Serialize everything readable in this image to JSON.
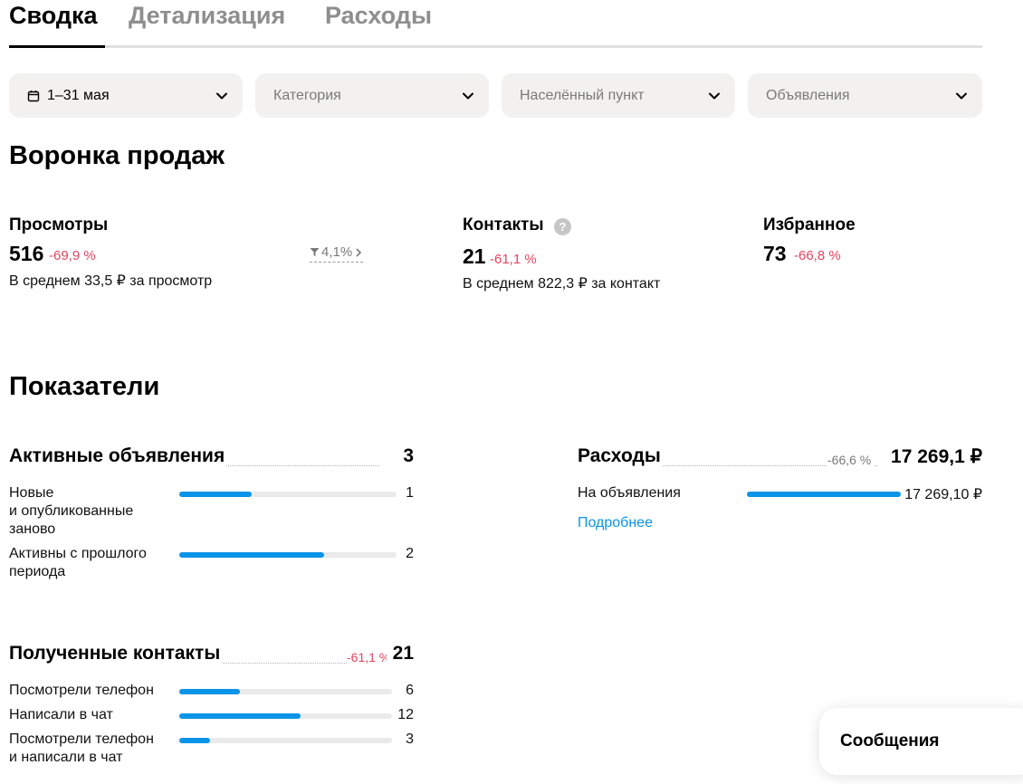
{
  "tabs": [
    {
      "label": "Сводка",
      "active": true
    },
    {
      "label": "Детализация",
      "active": false
    },
    {
      "label": "Расходы",
      "active": false
    }
  ],
  "filters": {
    "date": "1–31 мая",
    "category": "Категория",
    "location": "Населённый пункт",
    "listings": "Объявления"
  },
  "funnel": {
    "title": "Воронка продаж",
    "views": {
      "title": "Просмотры",
      "value": "516",
      "delta": "-69,9 %",
      "sub": "В среднем 33,5 ₽ за просмотр"
    },
    "conversion": "4,1%",
    "contacts": {
      "title": "Контакты",
      "help": "?",
      "value": "21",
      "delta": "-61,1 %",
      "sub": "В среднем 822,3 ₽ за контакт"
    },
    "favorites": {
      "title": "Избранное",
      "value": "73",
      "delta": "-66,8 %"
    }
  },
  "indicators": {
    "title": "Показатели",
    "active_listings": {
      "title": "Активные объявления",
      "total": "3",
      "rows": [
        {
          "label": "Новые\nи опубликованные\nзаново",
          "value": "1",
          "fraction": 0.333
        },
        {
          "label": "Активны с прошлого\nпериода",
          "value": "2",
          "fraction": 0.667
        }
      ]
    },
    "expenses": {
      "title": "Расходы",
      "delta": "-66,6 %",
      "total": "17 269,1 ₽",
      "rows": [
        {
          "label": "На объявления",
          "value": "17 269,10 ₽",
          "fraction": 1.0
        }
      ],
      "more_link": "Подробнее"
    },
    "contacts_received": {
      "title": "Полученные контакты",
      "delta": "-61,1 %",
      "total": "21",
      "rows": [
        {
          "label": "Посмотрели телефон",
          "value": "6",
          "fraction": 0.286
        },
        {
          "label": "Написали в чат",
          "value": "12",
          "fraction": 0.571
        },
        {
          "label": "Посмотрели телефон\nи написали в чат",
          "value": "3",
          "fraction": 0.143
        }
      ]
    }
  },
  "messages_button": "Сообщения",
  "colors": {
    "accent": "#0a94e8",
    "negative": "#e5435f",
    "muted": "#8e8e8e",
    "filter_bg": "#f2f1f0"
  }
}
